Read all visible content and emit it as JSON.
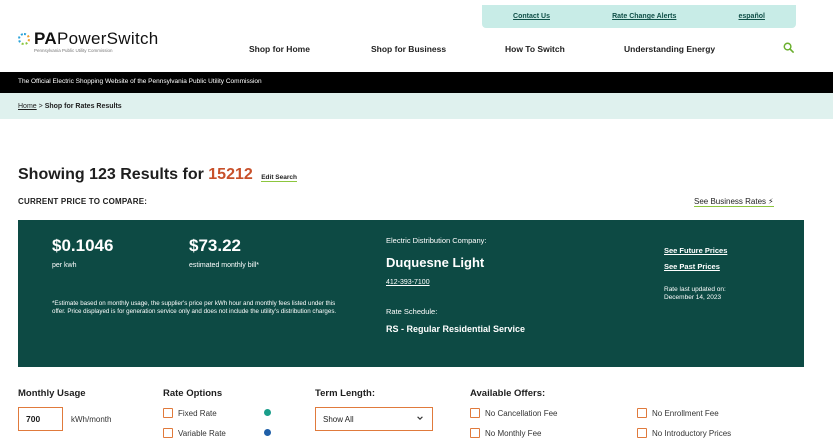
{
  "utility_nav": {
    "contact_us": "Contact Us",
    "rate_change_alerts": "Rate Change Alerts",
    "espanol": "español"
  },
  "logo": {
    "pa": "PA",
    "powerswitch": "PowerSwitch",
    "subtitle": "Pennsylvania Public Utility Commission"
  },
  "main_nav": {
    "shop_home": "Shop for Home",
    "shop_business": "Shop for Business",
    "how_to_switch": "How To Switch",
    "understanding_energy": "Understanding Energy"
  },
  "banner": {
    "text": "The Official Electric Shopping Website of the Pennsylvania Public Utility Commission"
  },
  "breadcrumb": {
    "home": "Home",
    "separator": ">",
    "current": "Shop for Rates Results"
  },
  "results": {
    "prefix": "Showing 123 Results for",
    "zip": "15212",
    "edit_search": "Edit Search"
  },
  "price_to_compare": {
    "heading": "CURRENT PRICE TO COMPARE:",
    "see_business_rates": "See Business Rates",
    "price": "$0.1046",
    "price_unit": "per kwh",
    "monthly_bill": "$73.22",
    "monthly_bill_label": "estimated monthly bill*",
    "disclaimer": "*Estimate based on monthly usage, the supplier's price per kWh hour and monthly fees listed under this offer. Price displayed is for generation service only and does not include the utility's distribution charges.",
    "edc_label": "Electric Distribution Company:",
    "edc_name": "Duquesne Light",
    "edc_phone": "412-393-7100",
    "rate_schedule_label": "Rate Schedule:",
    "rate_schedule": "RS - Regular Residential Service",
    "see_future_prices": "See Future Prices",
    "see_past_prices": "See Past Prices",
    "last_updated_label": "Rate last updated on:",
    "last_updated_date": "December 14, 2023"
  },
  "filters": {
    "monthly_usage_label": "Monthly Usage",
    "usage_value": "700",
    "usage_unit": "kWh/month",
    "rate_options_label": "Rate Options",
    "fixed_rate": "Fixed Rate",
    "variable_rate": "Variable Rate",
    "term_length_label": "Term Length:",
    "term_selected": "Show All",
    "available_offers_label": "Available Offers:",
    "no_cancellation_fee": "No Cancellation Fee",
    "no_monthly_fee": "No Monthly Fee",
    "no_enrollment_fee": "No Enrollment Fee",
    "no_introductory_prices": "No Introductory Prices"
  },
  "colors": {
    "panel": "#0d4a44",
    "accent_orange": "#c8502a",
    "fixed_dot": "#1a9e8a",
    "variable_dot": "#1f5fa8",
    "utility_bar": "#c8ece7",
    "green_underline": "#8cc63e"
  }
}
